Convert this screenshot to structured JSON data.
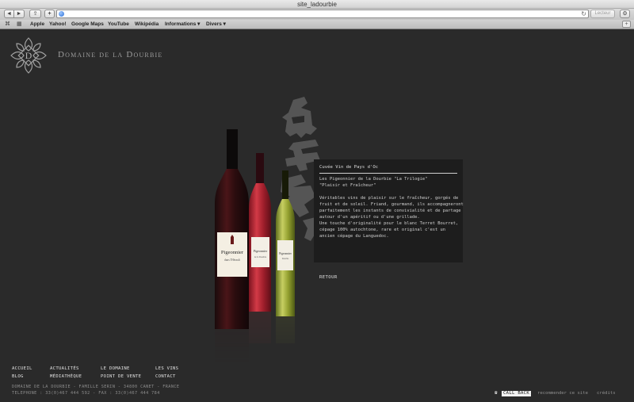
{
  "browser": {
    "window_title": "site_ladourbie",
    "nav_back": "◄",
    "nav_forward": "►",
    "share_glyph": "⇪",
    "add_glyph": "+",
    "reload_glyph": "↻",
    "reader_label": "Lecteur",
    "gear_glyph": "⚙",
    "reading_list_glyph": "⌘",
    "top_sites_glyph": "▦",
    "bookmarks": [
      {
        "label": "Apple"
      },
      {
        "label": "Yahoo!"
      },
      {
        "label": "Google Maps"
      },
      {
        "label": "YouTube"
      },
      {
        "label": "Wikipédia"
      },
      {
        "label": "Informations ▾"
      },
      {
        "label": "Divers ▾"
      }
    ],
    "new_tab_glyph": "+"
  },
  "site": {
    "brand": "Domaine de la Dourbie",
    "logo_letter": "D",
    "watermark_colors": "#5e5e5e",
    "wine_box": {
      "heading": "Cuvée Vin de Pays d'Oc",
      "lines": [
        "Les Pigeonnier de la Dourbie \"La Trilogie\"",
        "\"Plaisir et Fraîcheur\"",
        "",
        "Véritables vins de plaisir sur le fraîcheur, gorgés de",
        "fruit et de soleil. Friand, gourmand, ils accompagneront",
        "parfaitement les instants de convivialité et de partage",
        "autour d'un apéritif ou d'une grillade.",
        "Une touche d'originalité pour le blanc Terret Bourret,",
        "cépage 100% autochtone, rare et original c'est un",
        "ancien cépage du Languedoc."
      ]
    },
    "retour_label": "RETOUR",
    "bottle_labels": {
      "red": "Pigeonnier",
      "red_sub": "dans l'Hérault",
      "rose": "Pigeonnier",
      "rose_sub": "de la Dourbie",
      "white": "Pigeonnier",
      "white_sub": "Dourbie"
    },
    "footer_nav": {
      "accueil": "ACCUEIL",
      "actualites": "ACTUALITÉS",
      "le_domaine": "LE DOMAINE",
      "les_vins": "LES VINS",
      "blog": "BLOG",
      "mediatheque": "MÉDIATHÈQUE",
      "point_de_vente": "POINT DE VENTE",
      "contact": "CONTACT"
    },
    "footer_address": [
      "DOMAINE DE LA DOURBIE - FAMILLE SERIN - 34800 CANET - FRANCE",
      "TELEPHONE : 33(0)467 444 592 - FAX : 33(0)467 444 784"
    ],
    "phone_glyph": "☎",
    "callback_label": "CALL BACK",
    "recommend_label": "recommender ce site",
    "credits_label": "crédits"
  }
}
